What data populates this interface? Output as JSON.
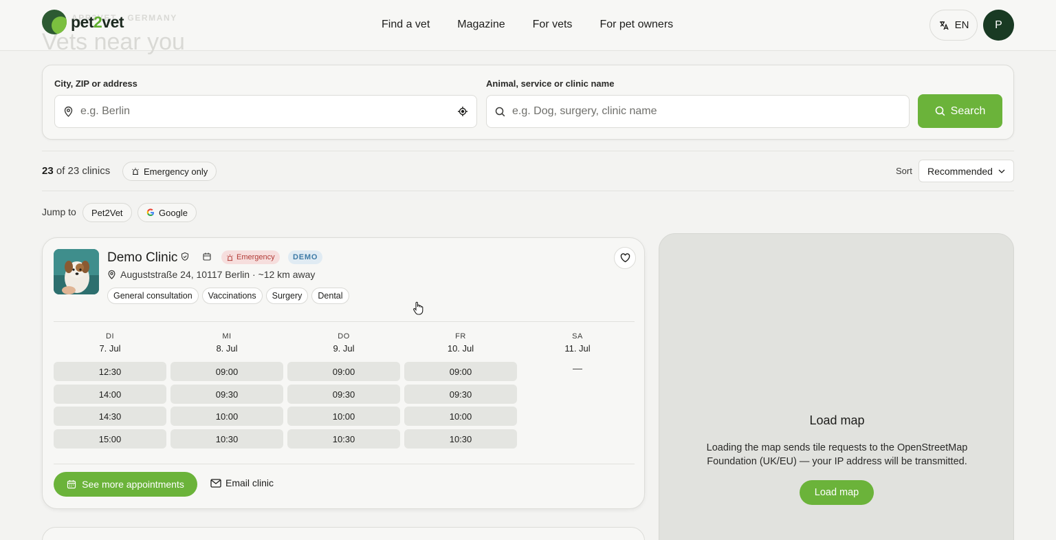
{
  "header": {
    "ghost_eyebrow": "APP2VET · GERMANY",
    "ghost_title": "Vets near you",
    "logo_prefix": "pet",
    "logo_mid": "2",
    "logo_suffix": "vet",
    "nav": [
      "Find a vet",
      "Magazine",
      "For vets",
      "For pet owners"
    ],
    "language": "EN",
    "avatar_initial": "P"
  },
  "search": {
    "location_label": "City, ZIP or address",
    "location_placeholder": "e.g. Berlin",
    "query_label": "Animal, service or clinic name",
    "query_placeholder": "e.g. Dog, surgery, clinic name",
    "button_label": "Search"
  },
  "results": {
    "shown": "23",
    "total_text": "of 23 clinics",
    "emergency_filter": "Emergency only",
    "sort_label": "Sort",
    "sort_value": "Recommended",
    "jump_label": "Jump to",
    "jump_links": [
      "Pet2Vet",
      "Google"
    ]
  },
  "clinic": {
    "name": "Demo Clinic",
    "badge_emergency": "Emergency",
    "badge_demo": "DEMO",
    "address": "Auguststraße 24, 10117 Berlin · ~12 km away",
    "services": [
      "General consultation",
      "Vaccinations",
      "Surgery",
      "Dental"
    ],
    "days": [
      {
        "dow": "DI",
        "date": "7. Jul",
        "slots": [
          "12:30",
          "14:00",
          "14:30",
          "15:00"
        ]
      },
      {
        "dow": "MI",
        "date": "8. Jul",
        "slots": [
          "09:00",
          "09:30",
          "10:00",
          "10:30"
        ]
      },
      {
        "dow": "DO",
        "date": "9. Jul",
        "slots": [
          "09:00",
          "09:30",
          "10:00",
          "10:30"
        ]
      },
      {
        "dow": "FR",
        "date": "10. Jul",
        "slots": [
          "09:00",
          "09:30",
          "10:00",
          "10:30"
        ]
      },
      {
        "dow": "SA",
        "date": "11. Jul",
        "slots": []
      }
    ],
    "no_slots": "—",
    "more_button": "See more appointments",
    "email_button": "Email clinic"
  },
  "map": {
    "title": "Load map",
    "description": "Loading the map sends tile requests to the OpenStreetMap Foundation (UK/EU) — your IP address will be transmitted.",
    "button": "Load map"
  },
  "colors": {
    "accent_green": "#6bb33a",
    "dark_green": "#193a23",
    "emergency_red": "#b13a35",
    "demo_blue": "#3d7aa6"
  }
}
